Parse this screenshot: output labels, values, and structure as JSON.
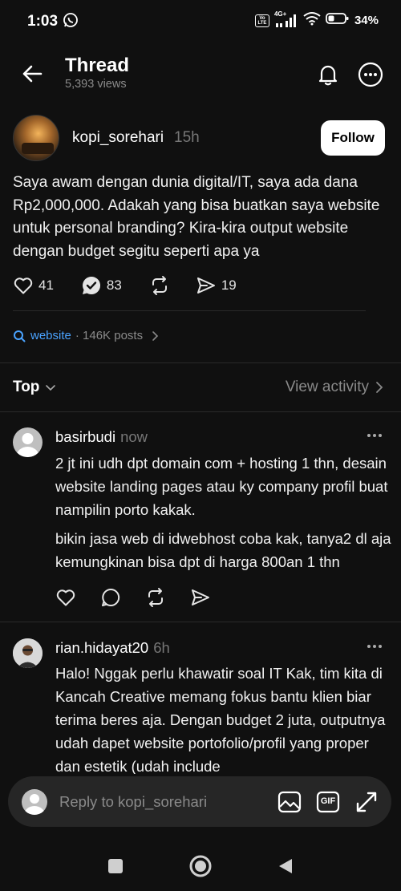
{
  "status_bar": {
    "time": "1:03",
    "network": "4G+",
    "volte": "Vo LTE",
    "battery": "34%"
  },
  "header": {
    "title": "Thread",
    "views": "5,393 views"
  },
  "post": {
    "username": "kopi_sorehari",
    "time": "15h",
    "follow_label": "Follow",
    "text": "Saya awam dengan dunia digital/IT, saya ada dana Rp2,000,000. Adakah yang bisa buatkan saya website untuk personal branding? Kira-kira output website dengan budget segitu seperti apa ya",
    "likes": "41",
    "replies": "83",
    "shares": "19"
  },
  "topic": {
    "label": "website",
    "posts": "· 146K posts"
  },
  "sort": {
    "label": "Top",
    "view_activity": "View activity"
  },
  "replies": [
    {
      "username": "basirbudi",
      "time": "now",
      "paragraphs": [
        "2 jt ini udh dpt domain com + hosting 1 thn, desain website landing pages atau ky company profil buat nampilin porto kakak.",
        "bikin jasa web di idwebhost coba kak, tanya2 dl aja kemungkinan bisa dpt di harga 800an 1 thn"
      ]
    },
    {
      "username": "rian.hidayat20",
      "time": "6h",
      "paragraphs": [
        "Halo! Nggak perlu khawatir soal IT Kak, tim kita di Kancah Creative memang fokus bantu klien biar terima beres aja. Dengan budget 2 juta, outputnya udah dapet website portofolio/profil yang proper dan estetik (udah include"
      ]
    }
  ],
  "reply_bar": {
    "placeholder": "Reply to kopi_sorehari",
    "gif_label": "GIF"
  },
  "colors": {
    "background": "#101010",
    "accent_link": "#4aa3ff",
    "muted": "#8a8a8a"
  }
}
